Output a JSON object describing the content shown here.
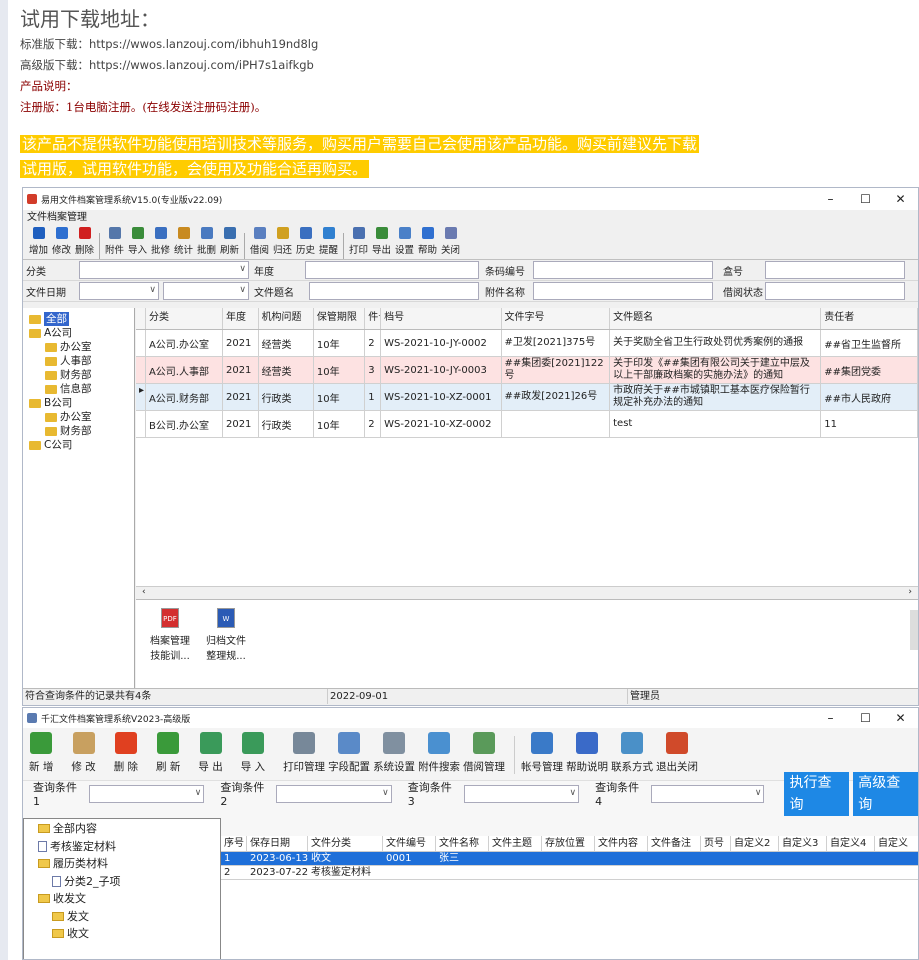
{
  "header": {
    "title": "试用下载地址：",
    "std_line": "标准版下载：https://wwos.lanzouj.com/ibhuh19nd8lg",
    "adv_line": "高级版下载：https://wwos.lanzouj.com/iPH7s1aifkgb",
    "prod_desc": "产品说明：",
    "reg_note": "注册版：1台电脑注册。(在线发送注册码注册)。",
    "warn1": "该产品不提供软件功能使用培训技术等服务，购买用户需要自己会使用该产品功能。购买前建议先下载",
    "warn2": "试用版，试用软件功能，会使用及功能合适再购买。"
  },
  "win1": {
    "title": "易用文件档案管理系统V15.0(专业版v22.09)",
    "menu": "文件档案管理",
    "toolbar": [
      {
        "label": "增加",
        "icon": "plus-icon",
        "color": "#1f5fbf"
      },
      {
        "label": "修改",
        "icon": "pencil-icon",
        "color": "#2e6fd0"
      },
      {
        "label": "删除",
        "icon": "delete-x-icon",
        "color": "#d02020"
      },
      {
        "label": "附件",
        "icon": "paperclip-icon",
        "color": "#5577aa"
      },
      {
        "label": "导入",
        "icon": "import-icon",
        "color": "#3a8c3a"
      },
      {
        "label": "批修",
        "icon": "batch-edit-icon",
        "color": "#3a6fc0"
      },
      {
        "label": "统计",
        "icon": "stats-icon",
        "color": "#c88a20"
      },
      {
        "label": "批删",
        "icon": "batch-delete-icon",
        "color": "#4a7ac0"
      },
      {
        "label": "刷新",
        "icon": "refresh-icon",
        "color": "#3a6fb0"
      },
      {
        "label": "借阅",
        "icon": "borrow-icon",
        "color": "#5a7fc0"
      },
      {
        "label": "归还",
        "icon": "return-icon",
        "color": "#d0a020"
      },
      {
        "label": "历史",
        "icon": "history-icon",
        "color": "#3a6fc0"
      },
      {
        "label": "提醒",
        "icon": "reminder-icon",
        "color": "#3080d0"
      },
      {
        "label": "打印",
        "icon": "print-icon",
        "color": "#4a70b0"
      },
      {
        "label": "导出",
        "icon": "export-icon",
        "color": "#3a8c3a"
      },
      {
        "label": "设置",
        "icon": "settings-icon",
        "color": "#4a80c8"
      },
      {
        "label": "帮助",
        "icon": "help-icon",
        "color": "#3070d0"
      },
      {
        "label": "关闭",
        "icon": "close-door-icon",
        "color": "#6a7ab0"
      }
    ],
    "filters": {
      "category": "分类",
      "year": "年度",
      "barcode": "条码编号",
      "box": "盒号",
      "file_date": "文件日期",
      "file_title": "文件题名",
      "attach_name": "附件名称",
      "borrow_status": "借阅状态"
    },
    "tree": [
      {
        "label": "全部",
        "level": 0,
        "selected": true
      },
      {
        "label": "A公司",
        "level": 0
      },
      {
        "label": "办公室",
        "level": 1
      },
      {
        "label": "人事部",
        "level": 1
      },
      {
        "label": "财务部",
        "level": 1
      },
      {
        "label": "信息部",
        "level": 1
      },
      {
        "label": "B公司",
        "level": 0
      },
      {
        "label": "办公室",
        "level": 1
      },
      {
        "label": "财务部",
        "level": 1
      },
      {
        "label": "C公司",
        "level": 0
      }
    ],
    "columns": [
      "分类",
      "年度",
      "机构问题",
      "保管期限",
      "件号",
      "档号",
      "文件字号",
      "文件题名",
      "责任者"
    ],
    "rows": [
      [
        "A公司.办公室",
        "2021",
        "经营类",
        "10年",
        "2",
        "WS-2021-10-JY-0002",
        "#卫发[2021]375号",
        "关于奖励全省卫生行政处罚优秀案例的通报",
        "##省卫生监督所"
      ],
      [
        "A公司.人事部",
        "2021",
        "经营类",
        "10年",
        "3",
        "WS-2021-10-JY-0003",
        "##集团委[2021]122号",
        "关于印发《##集团有限公司关于建立中层及以上干部廉政档案的实施办法》的通知",
        "##集团党委"
      ],
      [
        "A公司.财务部",
        "2021",
        "行政类",
        "10年",
        "1",
        "WS-2021-10-XZ-0001",
        "##政发[2021]26号",
        "市政府关于##市城镇职工基本医疗保险暂行规定补充办法的通知",
        "##市人民政府"
      ],
      [
        "B公司.办公室",
        "2021",
        "行政类",
        "10年",
        "2",
        "WS-2021-10-XZ-0002",
        "",
        "test",
        "11"
      ]
    ],
    "attachments": [
      {
        "label1": "档案管理",
        "label2": "技能训...",
        "icon": "pdf-icon"
      },
      {
        "label1": "归档文件",
        "label2": "整理规...",
        "icon": "word-icon"
      }
    ],
    "status_count": "符合查询条件的记录共有4条",
    "status_date": "2022-09-01",
    "status_user": "管理员"
  },
  "win2": {
    "title": "千汇文件档案管理系统V2023-高级版",
    "toolbar": [
      {
        "label": "新 增",
        "icon": "plus-icon",
        "color": "#3a9a3a"
      },
      {
        "label": "修 改",
        "icon": "edit-icon",
        "color": "#c8a060"
      },
      {
        "label": "删 除",
        "icon": "delete-x-icon",
        "color": "#e04020"
      },
      {
        "label": "刷 新",
        "icon": "refresh-icon",
        "color": "#3a9a3a"
      },
      {
        "label": "导 出",
        "icon": "export-excel-icon",
        "color": "#3a9a5a"
      },
      {
        "label": "导 入",
        "icon": "import-excel-icon",
        "color": "#3a9a5a"
      },
      {
        "label": "打印管理",
        "icon": "printer-icon",
        "color": "#778899"
      },
      {
        "label": "字段配置",
        "icon": "table-config-icon",
        "color": "#5a8ac8"
      },
      {
        "label": "系统设置",
        "icon": "tools-icon",
        "color": "#8090a0"
      },
      {
        "label": "附件搜索",
        "icon": "magnifier-icon",
        "color": "#4a90d0"
      },
      {
        "label": "借阅管理",
        "icon": "calendar-icon",
        "color": "#5a9a5a"
      },
      {
        "label": "帐号管理",
        "icon": "users-icon",
        "color": "#3a7ac8"
      },
      {
        "label": "帮助说明",
        "icon": "help-icon",
        "color": "#3a6ac8"
      },
      {
        "label": "联系方式",
        "icon": "monitor-icon",
        "color": "#4a90c8"
      },
      {
        "label": "退出关闭",
        "icon": "exit-icon",
        "color": "#d04a2a"
      }
    ],
    "query": [
      "查询条件1",
      "查询条件2",
      "查询条件3",
      "查询条件4"
    ],
    "exec_btn": "执行查询",
    "adv_btn": "高级查询",
    "tree": [
      {
        "label": "全部内容",
        "level": 0,
        "type": "folder"
      },
      {
        "label": "考核鉴定材料",
        "level": 0,
        "type": "doc"
      },
      {
        "label": "履历类材料",
        "level": 0,
        "type": "folder"
      },
      {
        "label": "分类2_子项",
        "level": 1,
        "type": "doc"
      },
      {
        "label": "收发文",
        "level": 0,
        "type": "folder"
      },
      {
        "label": "发文",
        "level": 1,
        "type": "folder"
      },
      {
        "label": "收文",
        "level": 1,
        "type": "folder"
      }
    ],
    "columns": [
      "序号",
      "保存日期",
      "文件分类",
      "文件编号",
      "文件名称",
      "文件主题",
      "存放位置",
      "文件内容",
      "文件备注",
      "页号",
      "自定义2",
      "自定义3",
      "自定义4",
      "自定义"
    ],
    "rows": [
      [
        "1",
        "2023-06-13",
        "收文",
        "0001",
        "张三",
        "",
        "",
        "",
        "",
        "",
        "",
        "",
        "",
        ""
      ],
      [
        "2",
        "2023-07-22",
        "考核鉴定材料",
        "",
        "",
        "",
        "",
        "",
        "",
        "",
        "",
        "",
        "",
        ""
      ]
    ]
  }
}
